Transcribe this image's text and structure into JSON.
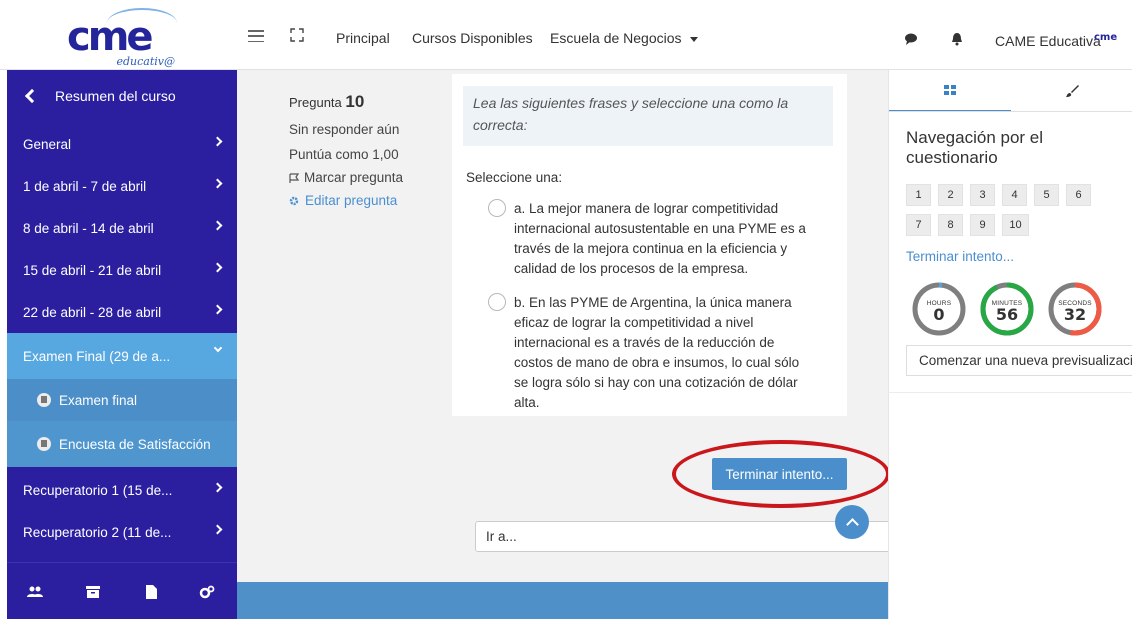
{
  "brand": {
    "logo_text": "cme",
    "logo_sub": "educativ@"
  },
  "topnav": {
    "links": [
      "Principal",
      "Cursos Disponibles",
      "Escuela de Negocios"
    ],
    "user_name": "CAME Educativa",
    "user_badge": "cme"
  },
  "sidebar": {
    "back_label": "Resumen del curso",
    "items": [
      "General",
      "1 de abril - 7 de abril",
      "8 de abril - 14 de abril",
      "15 de abril - 21 de abril",
      "22 de abril - 28 de abril",
      "Examen Final (29 de a...",
      "Examen final",
      "Encuesta de Satisfacción",
      "Recuperatorio 1 (15 de...",
      "Recuperatorio 2 (11 de..."
    ]
  },
  "question_info": {
    "label": "Pregunta",
    "number": "10",
    "status": "Sin responder aún",
    "score": "Puntúa como 1,00",
    "flag": "Marcar pregunta",
    "edit": "Editar pregunta"
  },
  "question": {
    "prompt": "Lea las siguientes frases y seleccione una como la correcta:",
    "select_one": "Seleccione una:",
    "options": [
      "a. La mejor manera de lograr competitividad internacional autosustentable  en una PYME es a través de la mejora continua en la eficiencia y calidad de los procesos de la empresa.",
      "b. En las PYME de Argentina, la única manera eficaz de lograr la competitividad a nivel internacional es a través de la reducción de costos de mano de obra e insumos, lo cual sólo se logra sólo si hay con una cotización de dólar alta."
    ]
  },
  "finish_button": "Terminar intento...",
  "goto_select": "Ir a...",
  "quiz_nav": {
    "title": "Navegación por el cuestionario",
    "buttons": [
      "1",
      "2",
      "3",
      "4",
      "5",
      "6",
      "7",
      "8",
      "9",
      "10"
    ],
    "finish_link": "Terminar intento...",
    "timers": [
      {
        "label": "HOURS",
        "value": "0",
        "progress": 0.02,
        "color": "#5a9fd6"
      },
      {
        "label": "MINUTES",
        "value": "56",
        "progress": 0.93,
        "color": "#27a844"
      },
      {
        "label": "SECONDS",
        "value": "32",
        "progress": 0.53,
        "color": "#ef5a45"
      }
    ],
    "preview_button": "Comenzar una nueva previsualización"
  },
  "colors": {
    "sidebar": "#2b1fa0",
    "sidebar_active": "#57a7e0",
    "accent": "#4a8fcc",
    "highlight_ring": "#c9171c"
  },
  "icons": [
    "hamburger-icon",
    "fullscreen-icon",
    "chat-icon",
    "bell-icon",
    "back-chevron-icon",
    "chevron-right-icon",
    "chevron-down-icon",
    "document-icon",
    "users-icon",
    "archive-icon",
    "file-icon",
    "gears-icon",
    "flag-icon",
    "gear-icon",
    "grid-icon",
    "brush-icon",
    "chevron-up-icon",
    "updown-icon"
  ]
}
